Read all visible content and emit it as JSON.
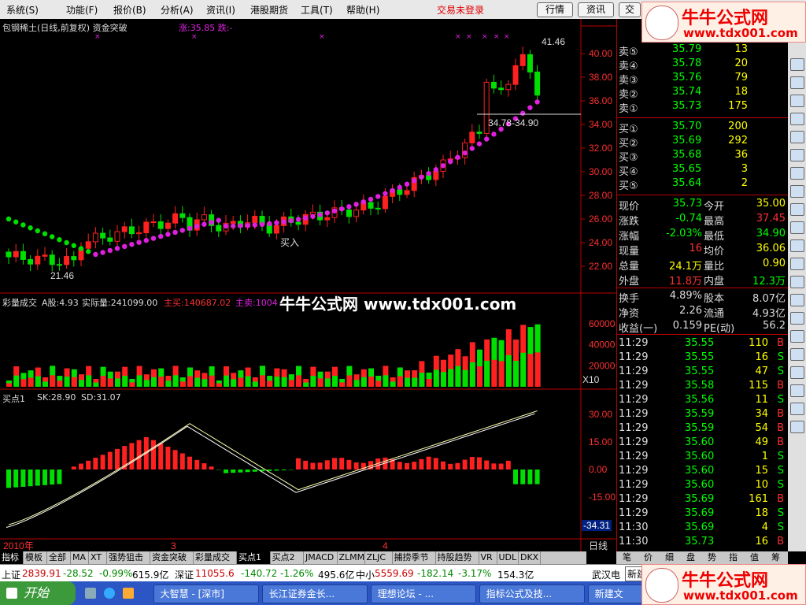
{
  "menu": {
    "items": [
      "系统(S)",
      "功能(F)",
      "报价(B)",
      "分析(A)",
      "资讯(I)",
      "港股期货",
      "工具(T)",
      "帮助(H)"
    ],
    "trade_status": "交易未登录",
    "buttons": [
      "行情",
      "资讯",
      "交"
    ]
  },
  "main_chart": {
    "title": "包钢稀土(日线,前复权) 资金突破",
    "indicator": "涨:35.85 跌:-",
    "high_label": "41.46",
    "low_label": "21.46",
    "range_label": "34.78-34.90",
    "buy_label": "买入",
    "y_ticks": [
      "40.00",
      "38.00",
      "36.00",
      "34.00",
      "32.00",
      "30.00",
      "28.00",
      "26.00",
      "24.00",
      "22.00"
    ]
  },
  "volume_panel": {
    "title": "彩量成交",
    "a_share": "A股:4.93",
    "actual": "实际量:241099.00",
    "main_buy": "主买:140687.02",
    "main_sell": "主卖:1004",
    "y_ticks": [
      "60000",
      "40000",
      "20000"
    ],
    "unit": "X10"
  },
  "macd_panel": {
    "title": "买点1",
    "sk": "SK:28.90",
    "sd": "SD:31.07",
    "y_ticks": [
      "30.00",
      "15.00",
      "0.00",
      "-15.00"
    ],
    "current": "-34.31"
  },
  "x_axis": {
    "year": "2010年",
    "m3": "3",
    "m4": "4",
    "period": "日线"
  },
  "quote": {
    "asks": [
      {
        "label": "卖⑤",
        "price": "35.79",
        "vol": "13"
      },
      {
        "label": "卖④",
        "price": "35.78",
        "vol": "20"
      },
      {
        "label": "卖③",
        "price": "35.76",
        "vol": "79"
      },
      {
        "label": "卖②",
        "price": "35.74",
        "vol": "18"
      },
      {
        "label": "卖①",
        "price": "35.73",
        "vol": "175"
      }
    ],
    "bids": [
      {
        "label": "买①",
        "price": "35.70",
        "vol": "200"
      },
      {
        "label": "买②",
        "price": "35.69",
        "vol": "292"
      },
      {
        "label": "买③",
        "price": "35.68",
        "vol": "36"
      },
      {
        "label": "买④",
        "price": "35.65",
        "vol": "3"
      },
      {
        "label": "买⑤",
        "price": "35.64",
        "vol": "2"
      }
    ],
    "stats": [
      {
        "k1": "现价",
        "v1": "35.73",
        "k2": "今开",
        "v2": "35.00",
        "c1": "#00ff00",
        "c2": "#ffff00"
      },
      {
        "k1": "涨跌",
        "v1": "-0.74",
        "k2": "最高",
        "v2": "37.45",
        "c1": "#00ff00",
        "c2": "#ff3030"
      },
      {
        "k1": "涨幅",
        "v1": "-2.03%",
        "k2": "最低",
        "v2": "34.90",
        "c1": "#00ff00",
        "c2": "#00ff00"
      },
      {
        "k1": "现量",
        "v1": "16",
        "k2": "均价",
        "v2": "36.06",
        "c1": "#ff3030",
        "c2": "#ffff00"
      },
      {
        "k1": "总量",
        "v1": "24.1万",
        "k2": "量比",
        "v2": "0.90",
        "c1": "#ffff00",
        "c2": "#ffff00"
      },
      {
        "k1": "外盘",
        "v1": "11.8万",
        "k2": "内盘",
        "v2": "12.3万",
        "c1": "#ff3030",
        "c2": "#00ff00"
      }
    ],
    "stats2": [
      {
        "k1": "换手",
        "v1": "4.89%",
        "k2": "股本",
        "v2": "8.07亿"
      },
      {
        "k1": "净资",
        "v1": "2.26",
        "k2": "流通",
        "v2": "4.93亿"
      },
      {
        "k1": "收益(一)",
        "v1": "0.159",
        "k2": "PE(动)",
        "v2": "56.2"
      }
    ],
    "ticks": [
      {
        "t": "11:29",
        "p": "35.55",
        "v": "110",
        "d": "B"
      },
      {
        "t": "11:29",
        "p": "35.55",
        "v": "16",
        "d": "S"
      },
      {
        "t": "11:29",
        "p": "35.55",
        "v": "47",
        "d": "S"
      },
      {
        "t": "11:29",
        "p": "35.58",
        "v": "115",
        "d": "B"
      },
      {
        "t": "11:29",
        "p": "35.56",
        "v": "11",
        "d": "S"
      },
      {
        "t": "11:29",
        "p": "35.59",
        "v": "34",
        "d": "B"
      },
      {
        "t": "11:29",
        "p": "35.59",
        "v": "54",
        "d": "B"
      },
      {
        "t": "11:29",
        "p": "35.60",
        "v": "49",
        "d": "B"
      },
      {
        "t": "11:29",
        "p": "35.60",
        "v": "1",
        "d": "S"
      },
      {
        "t": "11:29",
        "p": "35.60",
        "v": "15",
        "d": "S"
      },
      {
        "t": "11:29",
        "p": "35.60",
        "v": "10",
        "d": "S"
      },
      {
        "t": "11:29",
        "p": "35.69",
        "v": "161",
        "d": "B"
      },
      {
        "t": "11:29",
        "p": "35.69",
        "v": "18",
        "d": "S"
      },
      {
        "t": "11:30",
        "p": "35.69",
        "v": "4",
        "d": "S"
      },
      {
        "t": "11:30",
        "p": "35.73",
        "v": "16",
        "d": "B"
      }
    ],
    "bottom_tabs": [
      "笔",
      "价",
      "细",
      "盘",
      "势",
      "指",
      "值",
      "筹"
    ]
  },
  "indicator_tabs": [
    "指标",
    "模板",
    "全部",
    "MA",
    "XT",
    "强势狙击",
    "资金突破",
    "彩量成交",
    "买点1",
    "买点2",
    "JMACD",
    "ZLMM",
    "ZLJC",
    "捕捞季节",
    "持股趋势",
    "VR",
    "UDL",
    "DKX"
  ],
  "ticker": {
    "sh_label": "上证",
    "sh_value": "2839.91",
    "sh_change": "-28.52",
    "sh_pct": "-0.99%",
    "sh_amount": "615.9亿",
    "sz_label": "深证",
    "sz_value": "11055.6",
    "sz_change": "-140.72",
    "sz_pct": "-1.26%",
    "sz_amount": "495.6亿",
    "zx_label": "中小",
    "zx_value": "5559.69",
    "zx_change": "-182.14",
    "zx_pct": "-3.17%",
    "zx_amount": "154.3亿",
    "right_text": "武汉电",
    "new_text": "新建"
  },
  "taskbar": {
    "start": "开始",
    "tasks": [
      "大智慧 - [深市]",
      "长江证券金长...",
      "理想论坛 - ...",
      "指标公式及技...",
      "新建文"
    ]
  },
  "watermark": {
    "brand": "牛牛公式网",
    "url": "www.tdx001.com",
    "center": "牛牛公式网 www.tdx001.com"
  },
  "colors": {
    "up": "#ff2020",
    "down": "#00e000",
    "magenta": "#e020e0",
    "yellow": "#ffff00"
  }
}
